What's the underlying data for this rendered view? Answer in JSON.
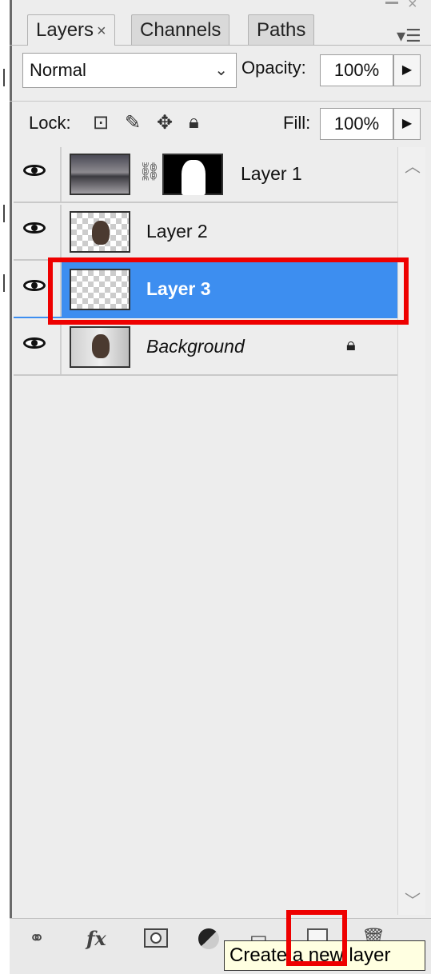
{
  "tabs": [
    {
      "label": "Layers",
      "active": true,
      "close": "×"
    },
    {
      "label": "Channels",
      "active": false
    },
    {
      "label": "Paths",
      "active": false
    }
  ],
  "panel_menu_icon": "panel-menu-icon",
  "blend": {
    "mode": "Normal",
    "opacity_label": "Opacity:",
    "opacity_value": "100%"
  },
  "lock": {
    "label": "Lock:",
    "fill_label": "Fill:",
    "fill_value": "100%"
  },
  "layers": [
    {
      "name": "Layer 1",
      "visible": true,
      "has_mask": true,
      "selected": false
    },
    {
      "name": "Layer 2",
      "visible": true,
      "has_mask": false,
      "selected": false
    },
    {
      "name": "Layer 3",
      "visible": true,
      "has_mask": false,
      "selected": true
    },
    {
      "name": "Background",
      "visible": true,
      "locked": true,
      "selected": false
    }
  ],
  "bottom_toolbar": {
    "fx_label": "fx",
    "buttons": [
      "link-layers-icon",
      "fx-icon",
      "add-mask-icon",
      "adjustment-layer-icon",
      "group-folder-icon",
      "new-layer-icon",
      "trash-icon"
    ]
  },
  "tooltip": "Create a new layer",
  "colors": {
    "selection": "#3d8ef0",
    "highlight": "#ee0000",
    "panel_bg": "#ededed"
  }
}
